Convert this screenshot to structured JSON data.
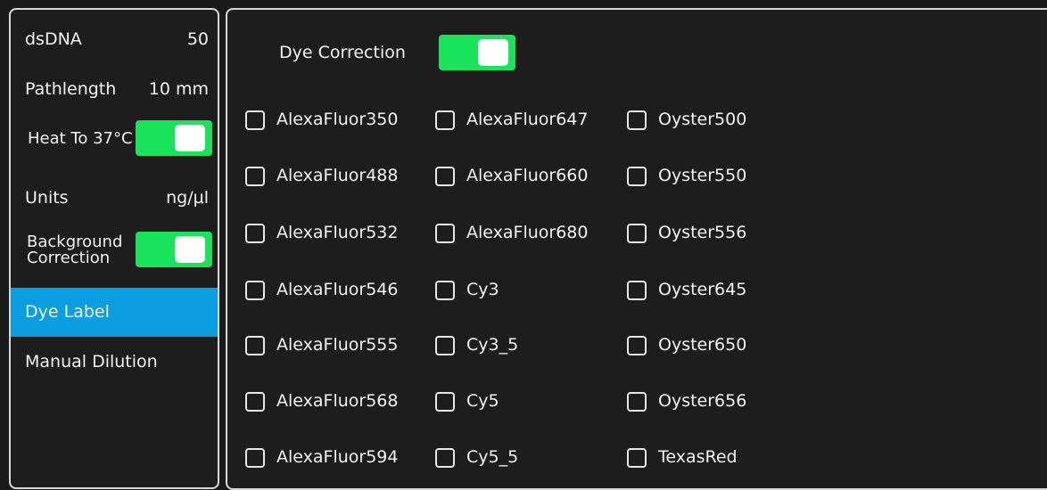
{
  "settings": {
    "dsdna": {
      "label": "dsDNA",
      "value": "50"
    },
    "pathlength": {
      "label": "Pathlength",
      "value": "10 mm"
    },
    "heat": {
      "label": "Heat To 37°C",
      "enabled": true
    },
    "units": {
      "label": "Units",
      "value": "ng/µl"
    },
    "background": {
      "label_line1": "Background",
      "label_line2": "Correction",
      "enabled": true
    },
    "dye_label": {
      "label": "Dye Label",
      "selected": true
    },
    "manual_dilution": {
      "label": "Manual Dilution"
    }
  },
  "dye_correction": {
    "label": "Dye Correction",
    "enabled": true
  },
  "dyes": {
    "col1": [
      "AlexaFluor350",
      "AlexaFluor488",
      "AlexaFluor532",
      "AlexaFluor546",
      "AlexaFluor555",
      "AlexaFluor568",
      "AlexaFluor594"
    ],
    "col2": [
      "AlexaFluor647",
      "AlexaFluor660",
      "AlexaFluor680",
      "Cy3",
      "Cy3_5",
      "Cy5",
      "Cy5_5"
    ],
    "col3": [
      "Oyster500",
      "Oyster550",
      "Oyster556",
      "Oyster645",
      "Oyster650",
      "Oyster656",
      "TexasRed"
    ]
  },
  "colors": {
    "accent_green": "#19e35a",
    "selection_blue": "#0a9ddf",
    "background": "#1a1a1a"
  }
}
